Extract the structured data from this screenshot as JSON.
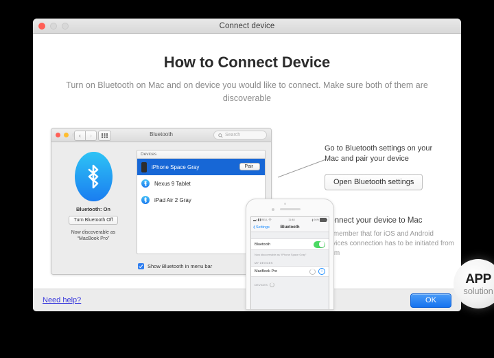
{
  "window": {
    "title": "Connect device",
    "traffic_lights": [
      "close",
      "minimize",
      "zoom"
    ]
  },
  "main": {
    "headline": "How to Connect Device",
    "subheadline": "Turn on Bluetooth on Mac and on device you would like to connect. Make sure both of them are discoverable"
  },
  "bluetooth_prefs_screenshot": {
    "toolbar": {
      "title": "Bluetooth",
      "back_icon": "chevron-left-icon",
      "forward_icon": "chevron-right-icon",
      "grid_icon": "grid-view-icon",
      "search_placeholder": "Search",
      "search_icon": "search-icon"
    },
    "left_panel": {
      "logo_icon": "bluetooth-logo-icon",
      "status": "Bluetooth: On",
      "toggle_button": "Turn Bluetooth Off",
      "discoverable_label": "Now discoverable as",
      "discoverable_name": "“MacBook Pro”"
    },
    "devices_header": "Devices",
    "devices": [
      {
        "name": "iPhone Space Gray",
        "icon": "iphone-icon",
        "selected": true,
        "action": "Pair"
      },
      {
        "name": "Nexus 9 Tablet",
        "icon": "bluetooth-device-icon",
        "selected": false,
        "action": ""
      },
      {
        "name": "iPad Air 2 Gray",
        "icon": "bluetooth-device-icon",
        "selected": false,
        "action": ""
      }
    ],
    "menu_bar_checkbox": {
      "label": "Show Bluetooth in menu bar",
      "checked": true
    }
  },
  "iphone_screenshot": {
    "status_bar": {
      "carrier": "BELL",
      "wifi_icon": "wifi-icon",
      "time": "11:48",
      "bluetooth_icon": "bluetooth-icon",
      "battery_percent": "94%",
      "battery_icon": "battery-icon"
    },
    "nav": {
      "back_label": "Settings",
      "back_icon": "chevron-left-icon",
      "title": "Bluetooth"
    },
    "bluetooth_row": {
      "label": "Bluetooth",
      "toggle_on": true
    },
    "discoverable_note": "Now discoverable as “iPhone Space Gray”",
    "my_devices_header": "MY DEVICES",
    "my_devices": [
      {
        "name": "MacBook Pro",
        "spinner_icon": "loading-spinner-icon",
        "info_icon": "info-icon"
      }
    ],
    "devices_header": "DEVICES",
    "devices_spinner_icon": "loading-spinner-icon"
  },
  "annotations": [
    {
      "id": "annotation-mac-pair",
      "text": "Go to Bluetooth settings on your Mac and pair your device",
      "button_label": "Open Bluetooth settings"
    },
    {
      "id": "annotation-connect-device",
      "title": "Connect your device to Mac",
      "body": "Remember that for iOS and Android devices connection has to be initiated from them"
    }
  ],
  "footer": {
    "help_link": "Need help?",
    "ok_button": "OK"
  },
  "watermark": {
    "line1": "APP",
    "line2": "solution"
  },
  "colors": {
    "accent_blue": "#1672ef",
    "selection_blue": "#1767d6",
    "link_blue": "#3b3bdd",
    "toggle_green": "#4cd964",
    "desktop_black": "#000000"
  }
}
